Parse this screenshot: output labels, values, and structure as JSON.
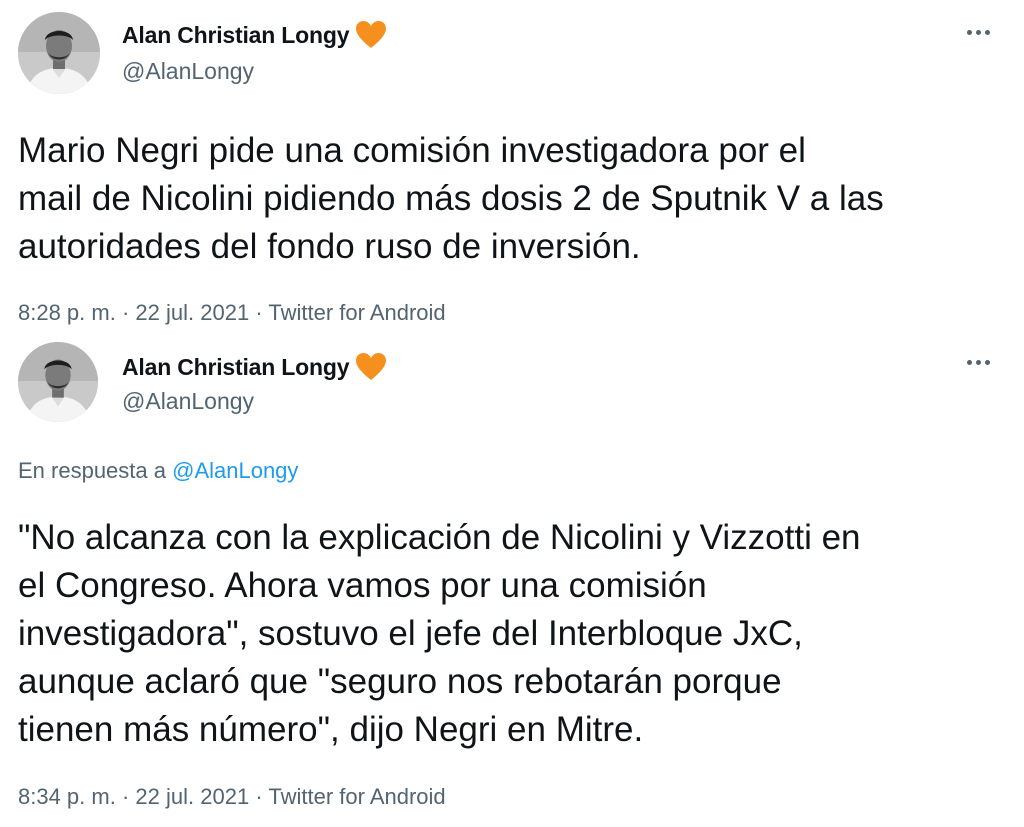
{
  "colors": {
    "text_primary": "#0f1419",
    "text_secondary": "#536471",
    "link": "#1d9bf0",
    "heart": "#f5901e"
  },
  "tweets": [
    {
      "author": {
        "name": "Alan Christian Longy",
        "handle": "@AlanLongy",
        "badge_icon": "orange-heart-icon"
      },
      "more_icon": "more-options-icon",
      "text": "Mario Negri pide una comisión investigadora por el\nmail de Nicolini pidiendo más dosis 2 de Sputnik V a las\nautoridades del fondo ruso de inversión.",
      "time": "8:28 p. m.",
      "date": "22 jul. 2021",
      "source": "Twitter for Android"
    },
    {
      "author": {
        "name": "Alan Christian Longy",
        "handle": "@AlanLongy",
        "badge_icon": "orange-heart-icon"
      },
      "more_icon": "more-options-icon",
      "reply_prefix": "En respuesta a",
      "reply_to": "@AlanLongy",
      "text": "\"No alcanza con la explicación de Nicolini y Vizzotti en\nel Congreso. Ahora vamos por una comisión\ninvestigadora\", sostuvo el jefe del Interbloque JxC,\naunque aclaró que \"seguro nos rebotarán porque\ntienen más número\", dijo Negri en Mitre.",
      "time": "8:34 p. m.",
      "date": "22 jul. 2021",
      "source": "Twitter for Android"
    }
  ]
}
